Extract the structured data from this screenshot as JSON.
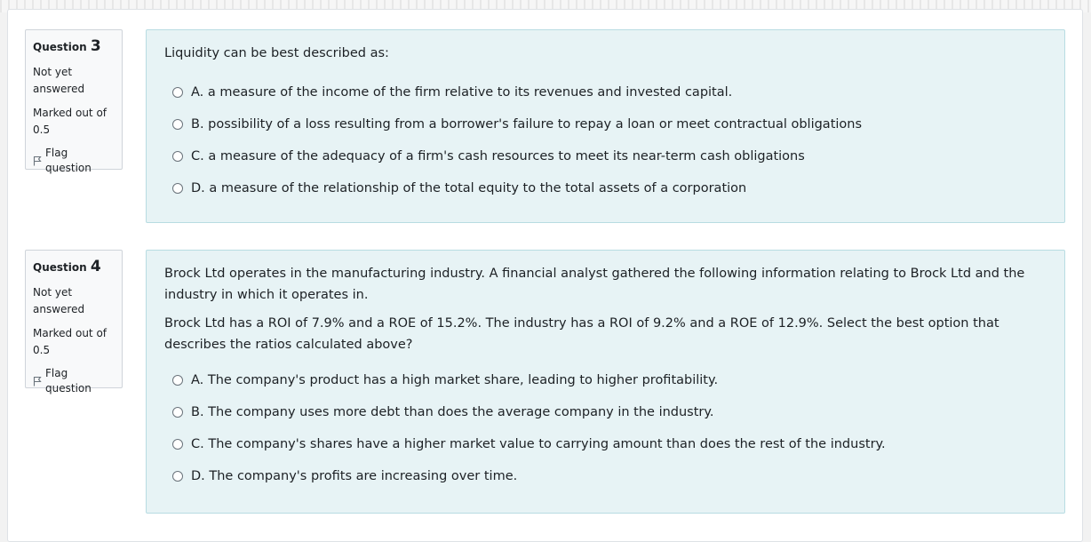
{
  "questions": [
    {
      "label": "Question",
      "number": "3",
      "state_line1": "Not yet",
      "state_line2": "answered",
      "grade_line1": "Marked out of",
      "grade_line2": "0.5",
      "flag_label": "Flag question",
      "text": [
        "Liquidity can be best described as:"
      ],
      "answers": [
        "A. a measure of the income of the firm relative to its revenues and invested capital.",
        "B. possibility of a loss resulting from a borrower's failure to repay a loan or meet contractual obligations",
        "C. a measure of the adequacy of a firm's cash resources to meet its near-term cash obligations",
        "D. a measure of the relationship of the total equity to the total assets of a corporation"
      ]
    },
    {
      "label": "Question",
      "number": "4",
      "state_line1": "Not yet",
      "state_line2": "answered",
      "grade_line1": "Marked out of",
      "grade_line2": "0.5",
      "flag_label": "Flag question",
      "text": [
        "Brock Ltd operates in the manufacturing industry. A financial analyst gathered the following information relating to Brock Ltd and the industry in which it operates in.",
        "Brock Ltd has a ROI of 7.9% and a ROE of 15.2%. The industry has a ROI of 9.2% and a ROE of 12.9%. Select the best option that describes the ratios calculated above?"
      ],
      "answers": [
        "A. The company's product has a high market share, leading to higher profitability.",
        "B. The company uses more debt than does the average company in the industry.",
        "C. The company's shares have a higher market value to carrying amount than does the rest of the industry.",
        "D. The company's profits are increasing over time."
      ]
    }
  ],
  "icons": {
    "flag": "flag-outline-icon"
  }
}
